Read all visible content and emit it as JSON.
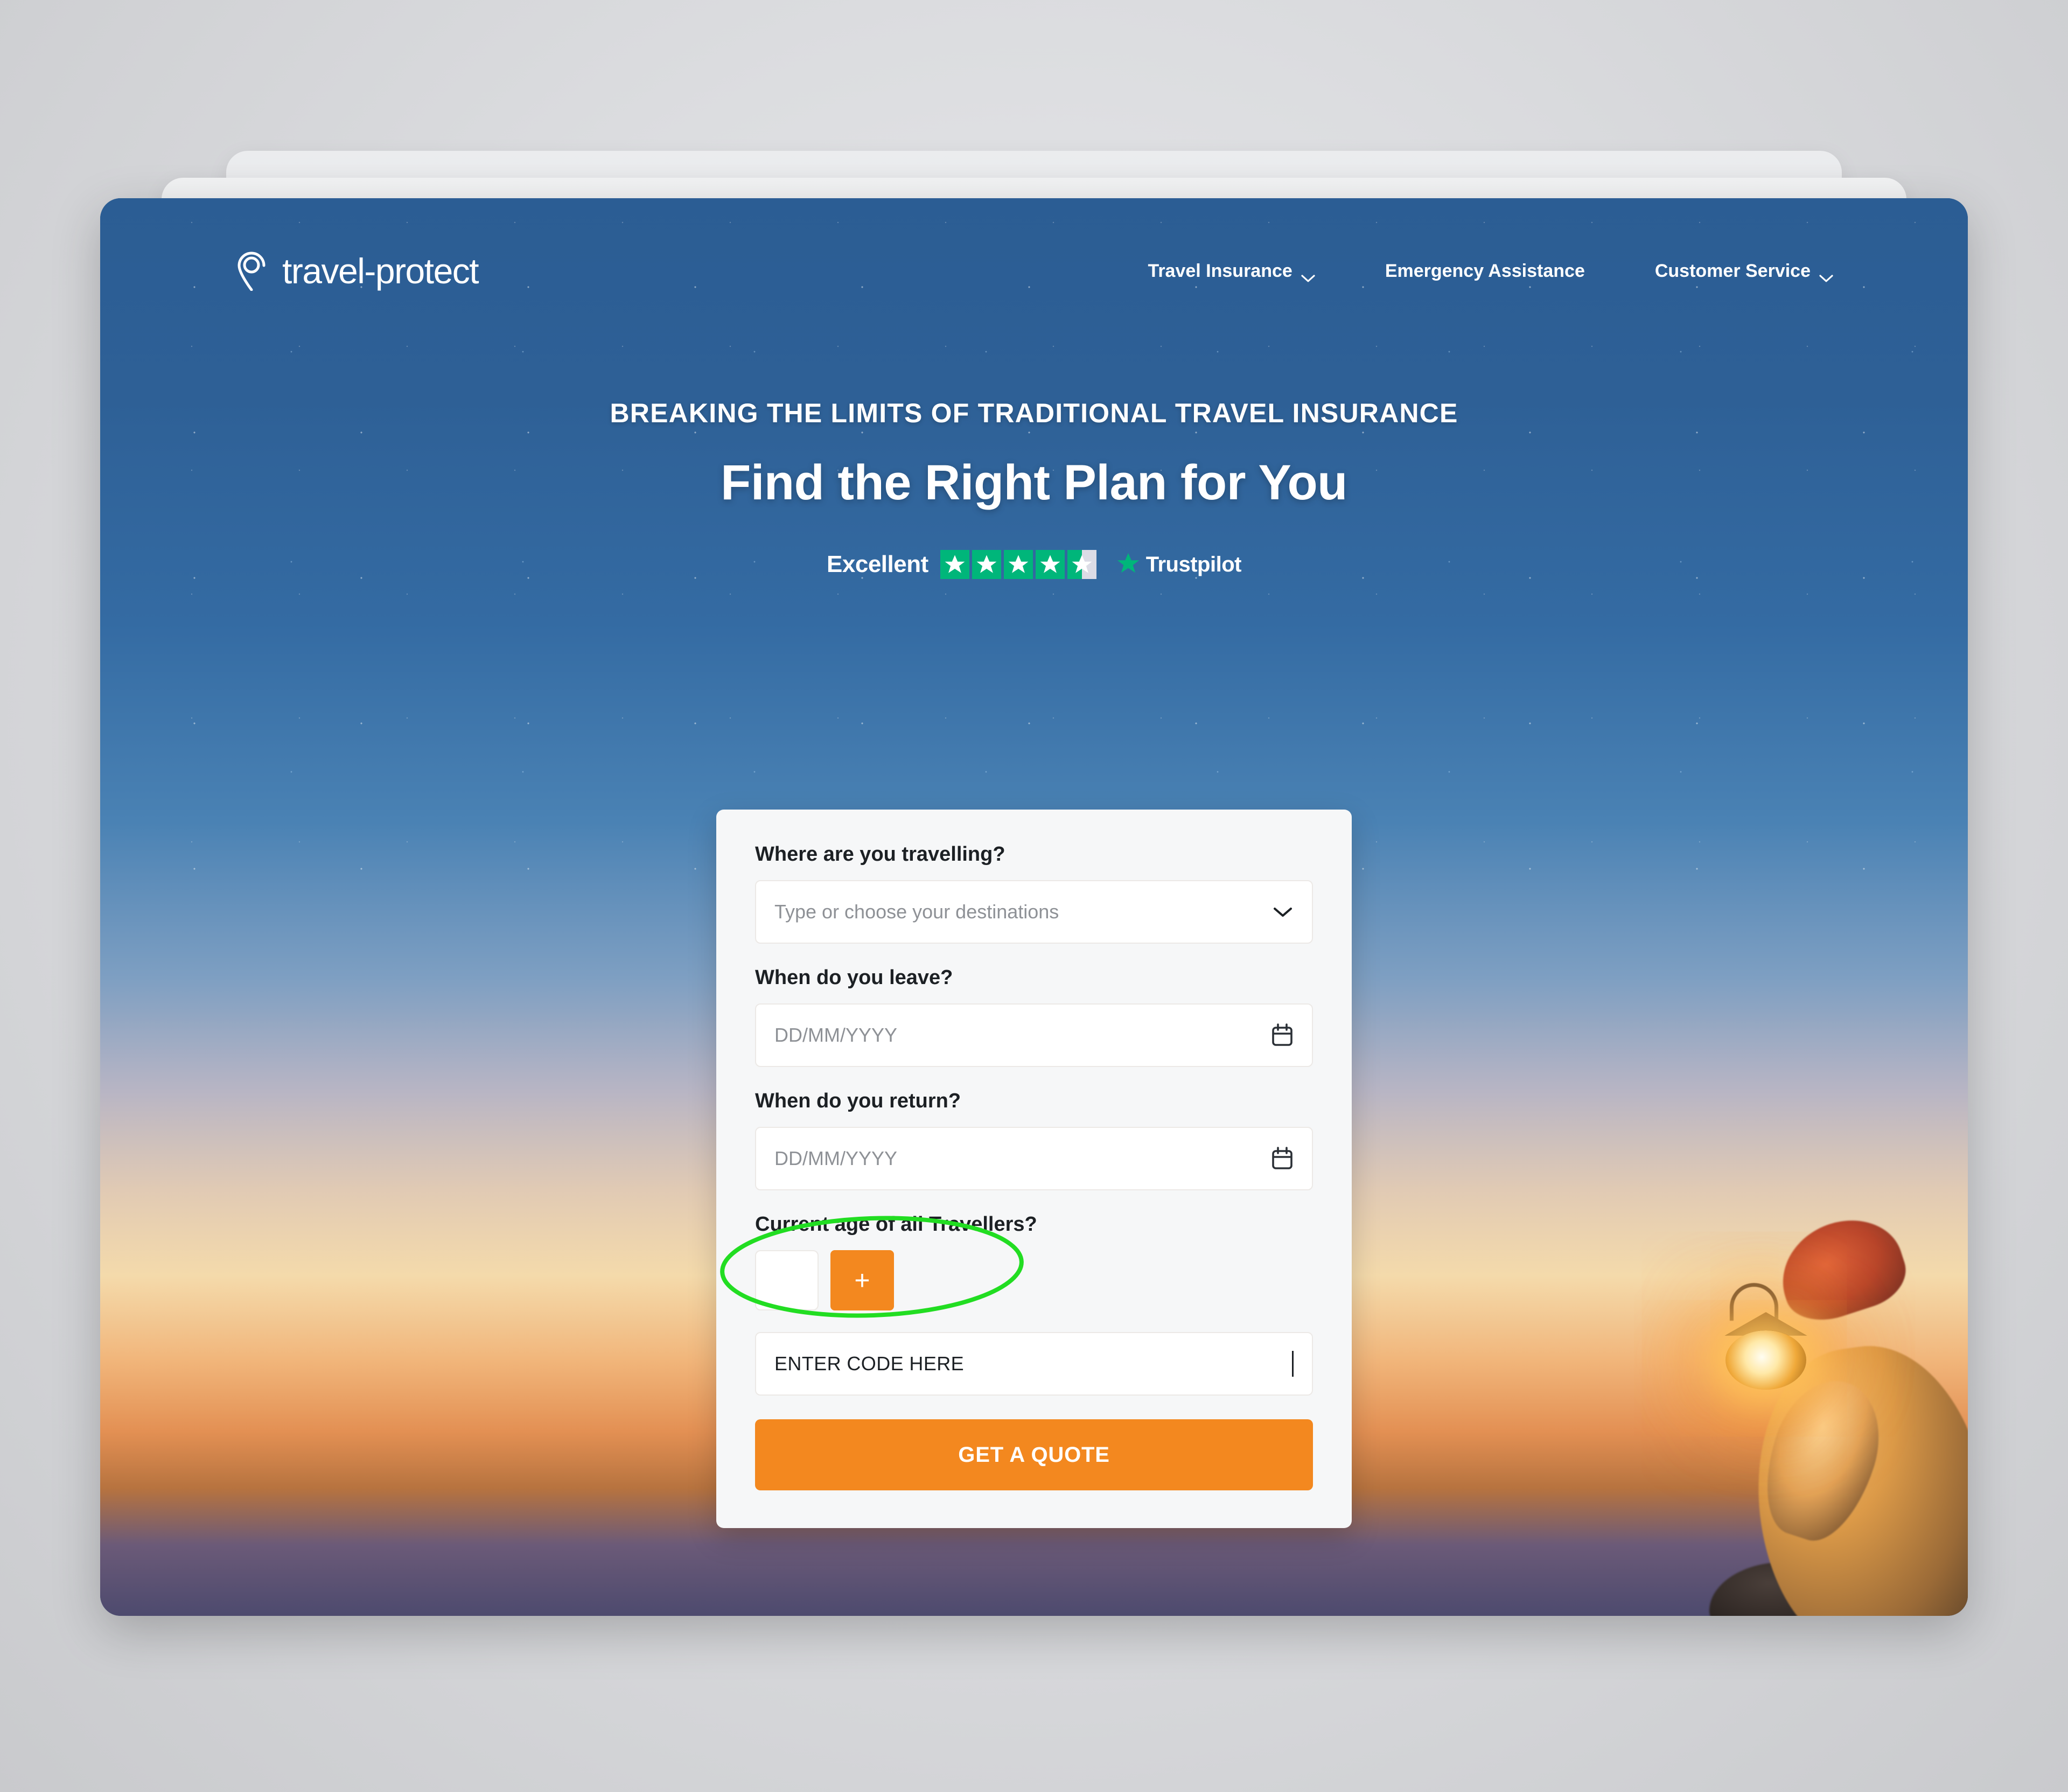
{
  "brand": {
    "name": "travel-protect",
    "logo_icon": "location-pin-icon",
    "accent_orange": "#f3881f",
    "header_blue": "#2e6096"
  },
  "nav": {
    "items": [
      {
        "label": "Travel Insurance",
        "has_chevron": true
      },
      {
        "label": "Emergency Assistance",
        "has_chevron": false
      },
      {
        "label": "Customer Service",
        "has_chevron": true
      }
    ]
  },
  "hero": {
    "eyebrow": "BREAKING THE LIMITS OF TRADITIONAL TRAVEL INSURANCE",
    "headline": "Find the Right Plan for You"
  },
  "trustpilot": {
    "rating_word": "Excellent",
    "stars_total": 5,
    "stars_filled": 4,
    "half_star": true,
    "brand_name": "Trustpilot",
    "star_color": "#00b67a",
    "empty_color": "#dcdce6"
  },
  "quote_form": {
    "destination": {
      "label": "Where are you travelling?",
      "placeholder": "Type or choose your destinations",
      "value": "",
      "icon": "chevron-down-icon"
    },
    "depart": {
      "label": "When do you leave?",
      "placeholder": "DD/MM/YYYY",
      "value": "",
      "icon": "calendar-icon"
    },
    "return": {
      "label": "When do you return?",
      "placeholder": "DD/MM/YYYY",
      "value": "",
      "icon": "calendar-icon"
    },
    "travellers": {
      "label": "Current age of all Travellers?",
      "age_value": "",
      "add_button_label": "+"
    },
    "code": {
      "value": "ENTER CODE HERE",
      "placeholder": "",
      "focused": true
    },
    "submit_label": "GET A QUOTE"
  },
  "annotation": {
    "shape": "ellipse",
    "color": "#22dd22",
    "stroke_width": 8,
    "targets": "code-input"
  }
}
